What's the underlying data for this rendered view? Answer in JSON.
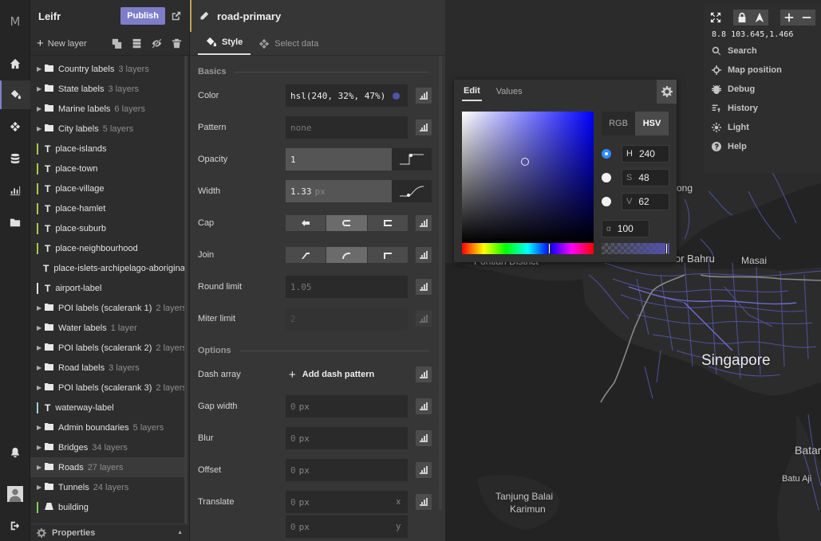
{
  "app": {
    "logo": "M"
  },
  "layer_list": {
    "title": "Leifr",
    "publish_label": "Publish",
    "new_layer_label": "New layer",
    "layers": [
      {
        "type": "group",
        "name": "Country labels",
        "count": "3 layers"
      },
      {
        "type": "group",
        "name": "State labels",
        "count": "3 layers"
      },
      {
        "type": "group",
        "name": "Marine labels",
        "count": "6 layers"
      },
      {
        "type": "group",
        "name": "City labels",
        "count": "5 layers"
      },
      {
        "type": "symbol",
        "name": "place-islands",
        "color": "#a9c94a"
      },
      {
        "type": "symbol",
        "name": "place-town",
        "color": "#a9c94a"
      },
      {
        "type": "symbol",
        "name": "place-village",
        "color": "#a9c94a"
      },
      {
        "type": "symbol",
        "name": "place-hamlet",
        "color": "#a9c94a"
      },
      {
        "type": "symbol",
        "name": "place-suburb",
        "color": "#a9c94a"
      },
      {
        "type": "symbol",
        "name": "place-neighbourhood",
        "color": "#a9c94a"
      },
      {
        "type": "symbol",
        "name": "place-islets-archipelago-aboriginal",
        "color": "#a9c94a"
      },
      {
        "type": "symbol",
        "name": "airport-label",
        "color": "#e0e0e0"
      },
      {
        "type": "group",
        "name": "POI labels (scalerank 1)",
        "count": "2 layers"
      },
      {
        "type": "group",
        "name": "Water labels",
        "count": "1 layer"
      },
      {
        "type": "group",
        "name": "POI labels (scalerank 2)",
        "count": "2 layers"
      },
      {
        "type": "group",
        "name": "Road labels",
        "count": "3 layers"
      },
      {
        "type": "group",
        "name": "POI labels (scalerank 3)",
        "count": "2 layers"
      },
      {
        "type": "symbol",
        "name": "waterway-label",
        "color": "#9fd0d8"
      },
      {
        "type": "group",
        "name": "Admin boundaries",
        "count": "5 layers"
      },
      {
        "type": "group",
        "name": "Bridges",
        "count": "34 layers"
      },
      {
        "type": "group",
        "name": "Roads",
        "count": "27 layers",
        "selected": true
      },
      {
        "type": "group",
        "name": "Tunnels",
        "count": "24 layers"
      },
      {
        "type": "fill",
        "name": "building",
        "color": "#7fcf5a"
      }
    ],
    "properties_label": "Properties"
  },
  "editor": {
    "layer_name": "road-primary",
    "tabs": {
      "style": "Style",
      "select_data": "Select data"
    },
    "sections": {
      "basics": "Basics",
      "options": "Options"
    },
    "props": {
      "color": {
        "label": "Color",
        "value": "hsl(240, 32%, 47%)"
      },
      "pattern": {
        "label": "Pattern",
        "placeholder": "none"
      },
      "opacity": {
        "label": "Opacity",
        "value": "1"
      },
      "width": {
        "label": "Width",
        "value": "1.33",
        "unit": "px"
      },
      "cap": {
        "label": "Cap"
      },
      "join": {
        "label": "Join"
      },
      "round_limit": {
        "label": "Round limit",
        "value": "1.05"
      },
      "miter_limit": {
        "label": "Miter limit",
        "value": "2"
      },
      "dash_array": {
        "label": "Dash array",
        "button": "Add dash pattern"
      },
      "gap_width": {
        "label": "Gap width",
        "value": "0",
        "unit": "px"
      },
      "blur": {
        "label": "Blur",
        "value": "0",
        "unit": "px"
      },
      "offset": {
        "label": "Offset",
        "value": "0",
        "unit": "px"
      },
      "translate": {
        "label": "Translate",
        "x_value": "0",
        "y_value": "0",
        "unit": "px",
        "x_axis": "x",
        "y_axis": "y"
      }
    }
  },
  "color_picker": {
    "tabs": {
      "edit": "Edit",
      "values": "Values"
    },
    "modes": {
      "rgb": "RGB",
      "hsv": "HSV"
    },
    "h": {
      "key": "H",
      "value": "240"
    },
    "s": {
      "key": "S",
      "value": "48"
    },
    "v": {
      "key": "V",
      "value": "62"
    },
    "alpha": {
      "key": "α",
      "value": "100"
    },
    "hue_fraction": 0.667,
    "alpha_fraction": 1.0,
    "accent": "#5252ad"
  },
  "map_controls": {
    "coords": "8.8 103.645,1.466",
    "items": {
      "search": "Search",
      "map_position": "Map position",
      "debug": "Debug",
      "history": "History",
      "light": "Light",
      "help": "Help"
    }
  },
  "map_labels": {
    "singapore": "Singapore",
    "johor_bahru": "or Bahru",
    "masai": "Masai",
    "pontian": "Pontian District",
    "ong": "ong",
    "batam": "Batar",
    "batu_aji": "Batu Aji",
    "tanjung_balai": "Tanjung Balai",
    "karimun": "Karimun"
  }
}
